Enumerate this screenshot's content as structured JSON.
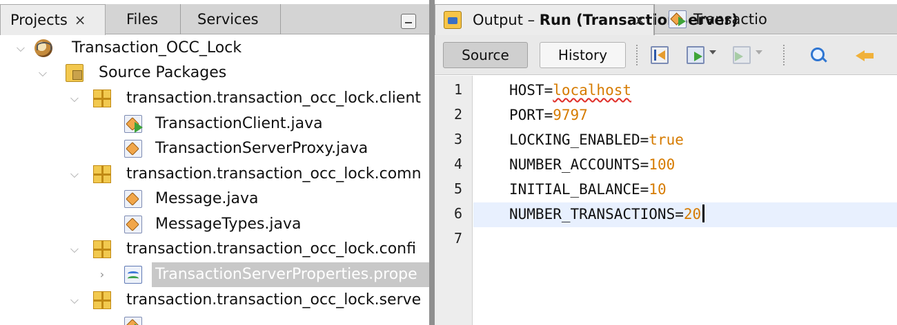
{
  "left_tabs": {
    "projects": "Projects",
    "files": "Files",
    "services": "Services",
    "close_symbol": "×"
  },
  "tree": {
    "project": "Transaction_OCC_Lock",
    "source_packages": "Source Packages",
    "packages": [
      {
        "name": "transaction.transaction_occ_lock.client",
        "files": [
          "TransactionClient.java",
          "TransactionServerProxy.java"
        ]
      },
      {
        "name": "transaction.transaction_occ_lock.comn",
        "files": [
          "Message.java",
          "MessageTypes.java"
        ]
      },
      {
        "name": "transaction.transaction_occ_lock.confi",
        "files": [
          "TransactionServerProperties.prope"
        ]
      },
      {
        "name": "transaction.transaction_occ_lock.serve",
        "files": []
      }
    ],
    "selected_file": "TransactionServerProperties.prope"
  },
  "editor_tabs": {
    "output_prefix": "Output – ",
    "output_bold": "Run (TransactionServer)",
    "close_symbol": "×",
    "second_tab": "Transactio"
  },
  "toolbar": {
    "source": "Source",
    "history": "History"
  },
  "editor": {
    "line_numbers": [
      "1",
      "2",
      "3",
      "4",
      "5",
      "6",
      "7"
    ],
    "lines": [
      {
        "key": "HOST=",
        "value": "localhost"
      },
      {
        "key": "PORT=",
        "value": "9797"
      },
      {
        "key": "LOCKING_ENABLED=",
        "value": "true"
      },
      {
        "key": "NUMBER_ACCOUNTS=",
        "value": "100"
      },
      {
        "key": "INITIAL_BALANCE=",
        "value": "10"
      },
      {
        "key": "NUMBER_TRANSACTIONS=",
        "value": "20"
      }
    ],
    "current_line": "6"
  },
  "colors": {
    "value_orange": "#d67b00",
    "current_line_bg": "#e8f0fe",
    "selection_bg": "#c8c8c8"
  }
}
